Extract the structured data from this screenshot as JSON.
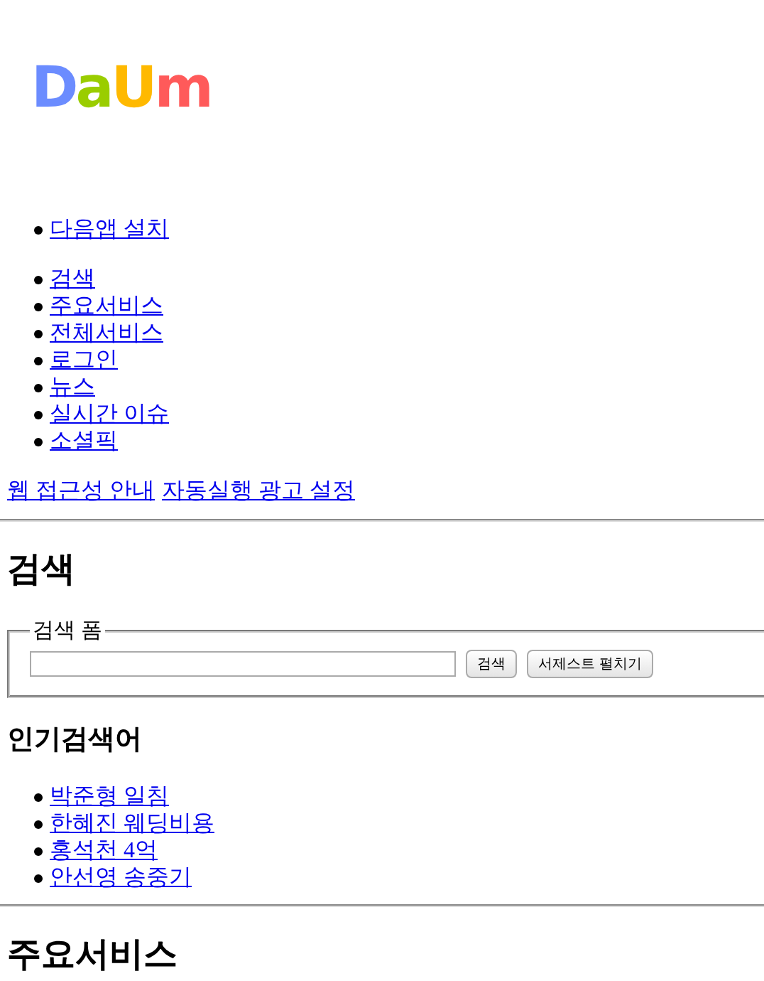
{
  "logo": {
    "letters": [
      {
        "char": "D",
        "color": "#6b8cff"
      },
      {
        "char": "a",
        "color": "#9acd00"
      },
      {
        "char": "U",
        "color": "#ffb900"
      },
      {
        "char": "m",
        "color": "#ff5a5a"
      }
    ]
  },
  "app_links": [
    "다음앱 설치"
  ],
  "nav_links": [
    "검색",
    "주요서비스",
    "전체서비스",
    "로그인",
    "뉴스",
    "실시간 이슈",
    "소셜픽"
  ],
  "utility_links": [
    "웹 접근성 안내",
    "자동실행 광고 설정"
  ],
  "search_section": {
    "heading": "검색",
    "form_legend": "검색 폼",
    "search_button": "검색",
    "suggest_button": "서제스트 펼치기"
  },
  "popular": {
    "heading": "인기검색어",
    "items": [
      "박준형 일침",
      "한혜진 웨딩비용",
      "홍석천 4억",
      "안선영 송중기"
    ]
  },
  "next_heading": "주요서비스"
}
